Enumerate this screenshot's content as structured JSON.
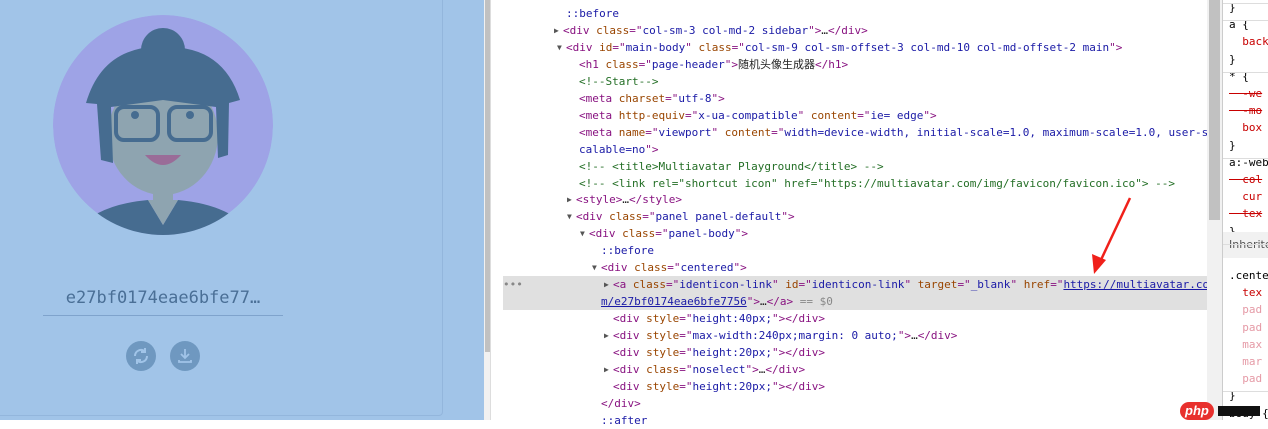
{
  "page": {
    "hash_display": "e27bf0174eae6bfe77…",
    "avatar_colors": {
      "background": "#9ea3e6",
      "hair": "#466c90",
      "skin": "#8ea4b0",
      "mouth": "#9a6c98",
      "band": "#a68aaa"
    },
    "buttons": {
      "refresh": "refresh-icon",
      "download": "download-icon"
    }
  },
  "elements": {
    "selected_suffix": " == $0",
    "lines": [
      {
        "tokens": [
          [
            "p",
            "::before"
          ]
        ]
      },
      {
        "tokens": [
          [
            "t",
            "<div "
          ],
          [
            "a",
            "class"
          ],
          [
            "t",
            "=\""
          ],
          [
            "v",
            "col-sm-3 col-md-2 sidebar"
          ],
          [
            "t",
            "\">"
          ],
          [
            "x",
            "…"
          ],
          [
            "t",
            "</div>"
          ]
        ],
        "tri": "▶"
      },
      {
        "tokens": [
          [
            "t",
            "<div "
          ],
          [
            "a",
            "id"
          ],
          [
            "t",
            "=\""
          ],
          [
            "v",
            "main-body"
          ],
          [
            "t",
            "\" "
          ],
          [
            "a",
            "class"
          ],
          [
            "t",
            "=\""
          ],
          [
            "v",
            "col-sm-9 col-sm-offset-3 col-md-10 col-md-offset-2 main"
          ],
          [
            "t",
            "\">"
          ]
        ],
        "tri": "▼"
      },
      {
        "tokens": [
          [
            "t",
            "<h1 "
          ],
          [
            "a",
            "class"
          ],
          [
            "t",
            "=\""
          ],
          [
            "v",
            "page-header"
          ],
          [
            "t",
            "\">"
          ],
          [
            "x",
            "随机头像生成器"
          ],
          [
            "t",
            "</h1>"
          ]
        ]
      },
      {
        "tokens": [
          [
            "c",
            "<!--Start-->"
          ]
        ]
      },
      {
        "tokens": [
          [
            "t",
            "<meta "
          ],
          [
            "a",
            "charset"
          ],
          [
            "t",
            "=\""
          ],
          [
            "v",
            "utf-8"
          ],
          [
            "t",
            "\">"
          ]
        ]
      },
      {
        "tokens": [
          [
            "t",
            "<meta "
          ],
          [
            "a",
            "http-equiv"
          ],
          [
            "t",
            "=\""
          ],
          [
            "v",
            "x-ua-compatible"
          ],
          [
            "t",
            "\" "
          ],
          [
            "a",
            "content"
          ],
          [
            "t",
            "=\""
          ],
          [
            "v",
            "ie= edge"
          ],
          [
            "t",
            "\">"
          ]
        ]
      },
      {
        "tokens": [
          [
            "t",
            "<meta "
          ],
          [
            "a",
            "name"
          ],
          [
            "t",
            "=\""
          ],
          [
            "v",
            "viewport"
          ],
          [
            "t",
            "\" "
          ],
          [
            "a",
            "content"
          ],
          [
            "t",
            "=\""
          ],
          [
            "v",
            "width=device-width, initial-scale=1.0, maximum-scale=1.0, user-s"
          ]
        ]
      },
      {
        "tokens": [
          [
            "v",
            "calable=no"
          ],
          [
            "t",
            "\">"
          ]
        ]
      },
      {
        "tokens": [
          [
            "c",
            "<!-- <title>Multiavatar Playground</title> -->"
          ]
        ]
      },
      {
        "tokens": [
          [
            "c",
            "<!-- <link rel=\"shortcut icon\" href=\"https://multiavatar.com/img/favicon/favicon.ico\"> -->"
          ]
        ]
      },
      {
        "tokens": [
          [
            "t",
            "<style>"
          ],
          [
            "x",
            "…"
          ],
          [
            "t",
            "</style>"
          ]
        ],
        "tri": "▶"
      },
      {
        "tokens": [
          [
            "t",
            "<div "
          ],
          [
            "a",
            "class"
          ],
          [
            "t",
            "=\""
          ],
          [
            "v",
            "panel panel-default"
          ],
          [
            "t",
            "\">"
          ]
        ],
        "tri": "▼"
      },
      {
        "tokens": [
          [
            "t",
            "<div "
          ],
          [
            "a",
            "class"
          ],
          [
            "t",
            "=\""
          ],
          [
            "v",
            "panel-body"
          ],
          [
            "t",
            "\">"
          ]
        ],
        "tri": "▼"
      },
      {
        "tokens": [
          [
            "p",
            "::before"
          ]
        ]
      },
      {
        "tokens": [
          [
            "t",
            "<div "
          ],
          [
            "a",
            "class"
          ],
          [
            "t",
            "=\""
          ],
          [
            "v",
            "centered"
          ],
          [
            "t",
            "\">"
          ]
        ],
        "tri": "▼"
      },
      {
        "tokens": [
          [
            "t",
            "<a "
          ],
          [
            "a",
            "class"
          ],
          [
            "t",
            "=\""
          ],
          [
            "v",
            "identicon-link"
          ],
          [
            "t",
            "\" "
          ],
          [
            "a",
            "id"
          ],
          [
            "t",
            "=\""
          ],
          [
            "v",
            "identicon-link"
          ],
          [
            "t",
            "\" "
          ],
          [
            "a",
            "target"
          ],
          [
            "t",
            "=\""
          ],
          [
            "v",
            "_blank"
          ],
          [
            "t",
            "\" "
          ],
          [
            "a",
            "href"
          ],
          [
            "t",
            "=\""
          ],
          [
            "lk",
            "https://multiavatar.co"
          ]
        ],
        "tri": "▶"
      },
      {
        "tokens": [
          [
            "lk",
            "m/e27bf0174eae6bfe7756"
          ],
          [
            "t",
            "\">"
          ],
          [
            "x",
            "…"
          ],
          [
            "t",
            "</a>"
          ],
          [
            "s",
            " == $0"
          ]
        ]
      },
      {
        "tokens": [
          [
            "t",
            "<div "
          ],
          [
            "a",
            "style"
          ],
          [
            "t",
            "=\""
          ],
          [
            "v",
            "height:40px;"
          ],
          [
            "t",
            "\"></div>"
          ]
        ]
      },
      {
        "tokens": [
          [
            "t",
            "<div "
          ],
          [
            "a",
            "style"
          ],
          [
            "t",
            "=\""
          ],
          [
            "v",
            "max-width:240px;margin: 0 auto;"
          ],
          [
            "t",
            "\">"
          ],
          [
            "x",
            "…"
          ],
          [
            "t",
            "</div>"
          ]
        ],
        "tri": "▶"
      },
      {
        "tokens": [
          [
            "t",
            "<div "
          ],
          [
            "a",
            "style"
          ],
          [
            "t",
            "=\""
          ],
          [
            "v",
            "height:20px;"
          ],
          [
            "t",
            "\"></div>"
          ]
        ]
      },
      {
        "tokens": [
          [
            "t",
            "<div "
          ],
          [
            "a",
            "class"
          ],
          [
            "t",
            "=\""
          ],
          [
            "v",
            "noselect"
          ],
          [
            "t",
            "\">"
          ],
          [
            "x",
            "…"
          ],
          [
            "t",
            "</div>"
          ]
        ],
        "tri": "▶"
      },
      {
        "tokens": [
          [
            "t",
            "<div "
          ],
          [
            "a",
            "style"
          ],
          [
            "t",
            "=\""
          ],
          [
            "v",
            "height:20px;"
          ],
          [
            "t",
            "\"></div>"
          ]
        ]
      },
      {
        "tokens": [
          [
            "t",
            "</div>"
          ]
        ]
      },
      {
        "tokens": [
          [
            "p",
            "::after"
          ]
        ]
      }
    ]
  },
  "styles": {
    "lines": [
      "}",
      "a {",
      "  back",
      "}",
      "* {",
      "  -we",
      "  -mo",
      "  box",
      "}",
      "a:-web",
      "  col",
      "  cur",
      "  tex",
      "}",
      "Inherite",
      ".cente",
      "  tex",
      "  pad",
      "  pad",
      "  max",
      "  mar",
      "  pad",
      "}",
      "body {"
    ]
  },
  "watermark": {
    "text": "php"
  }
}
